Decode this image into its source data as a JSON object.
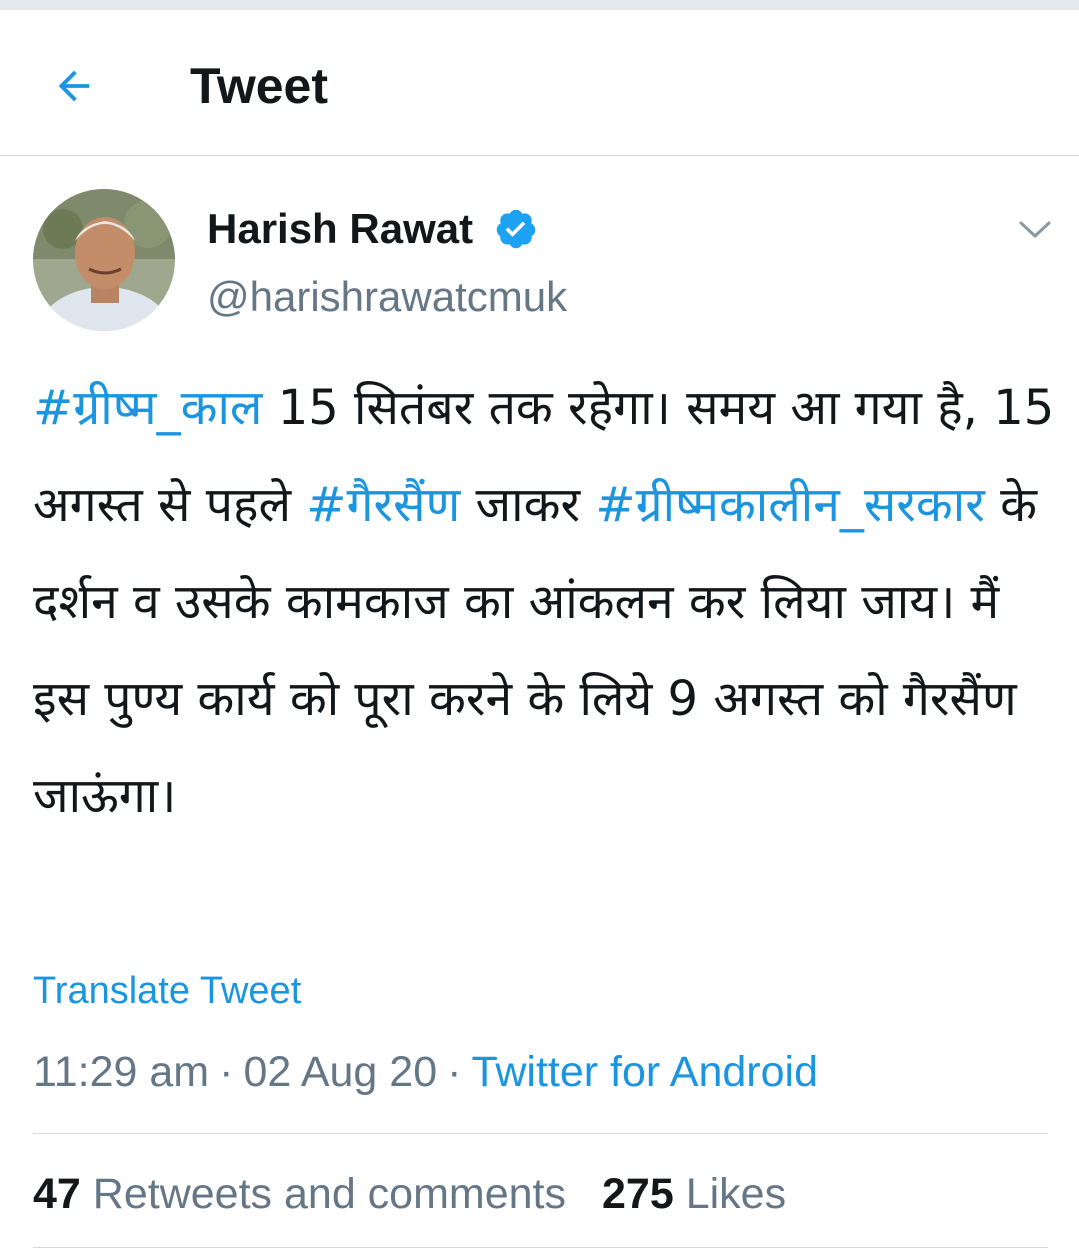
{
  "header": {
    "title": "Tweet",
    "back_icon": "arrow-left-icon"
  },
  "author": {
    "name": "Harish Rawat",
    "handle": "@harishrawatcmuk",
    "verified": true,
    "menu_icon": "chevron-down-icon"
  },
  "tweet": {
    "seg0": "#ग्रीष्म_काल",
    "seg1": " 15 सितंबर तक रहेगा। समय आ गया है, 15 अगस्त से पहले ",
    "seg2": "#गैरसैंण",
    "seg3": " जाकर ",
    "seg4": "#ग्रीष्मकालीन_सरकार",
    "seg5": " के दर्शन व उसके कामकाज का आंकलन कर लिया जाय। मैं इस पुण्य कार्य को पूरा करने के लिये 9 अगस्त को गैरसैंण जाऊंगा।"
  },
  "translate_label": "Translate Tweet",
  "meta": {
    "time": "11:29 am",
    "date": "02 Aug 20",
    "separator": "·",
    "source": "Twitter for Android"
  },
  "stats": {
    "retweets_count": "47",
    "retweets_label": "Retweets and comments",
    "likes_count": "275",
    "likes_label": "Likes"
  },
  "colors": {
    "accent": "#1b95e0",
    "text": "#14171a",
    "secondary": "#657786"
  }
}
